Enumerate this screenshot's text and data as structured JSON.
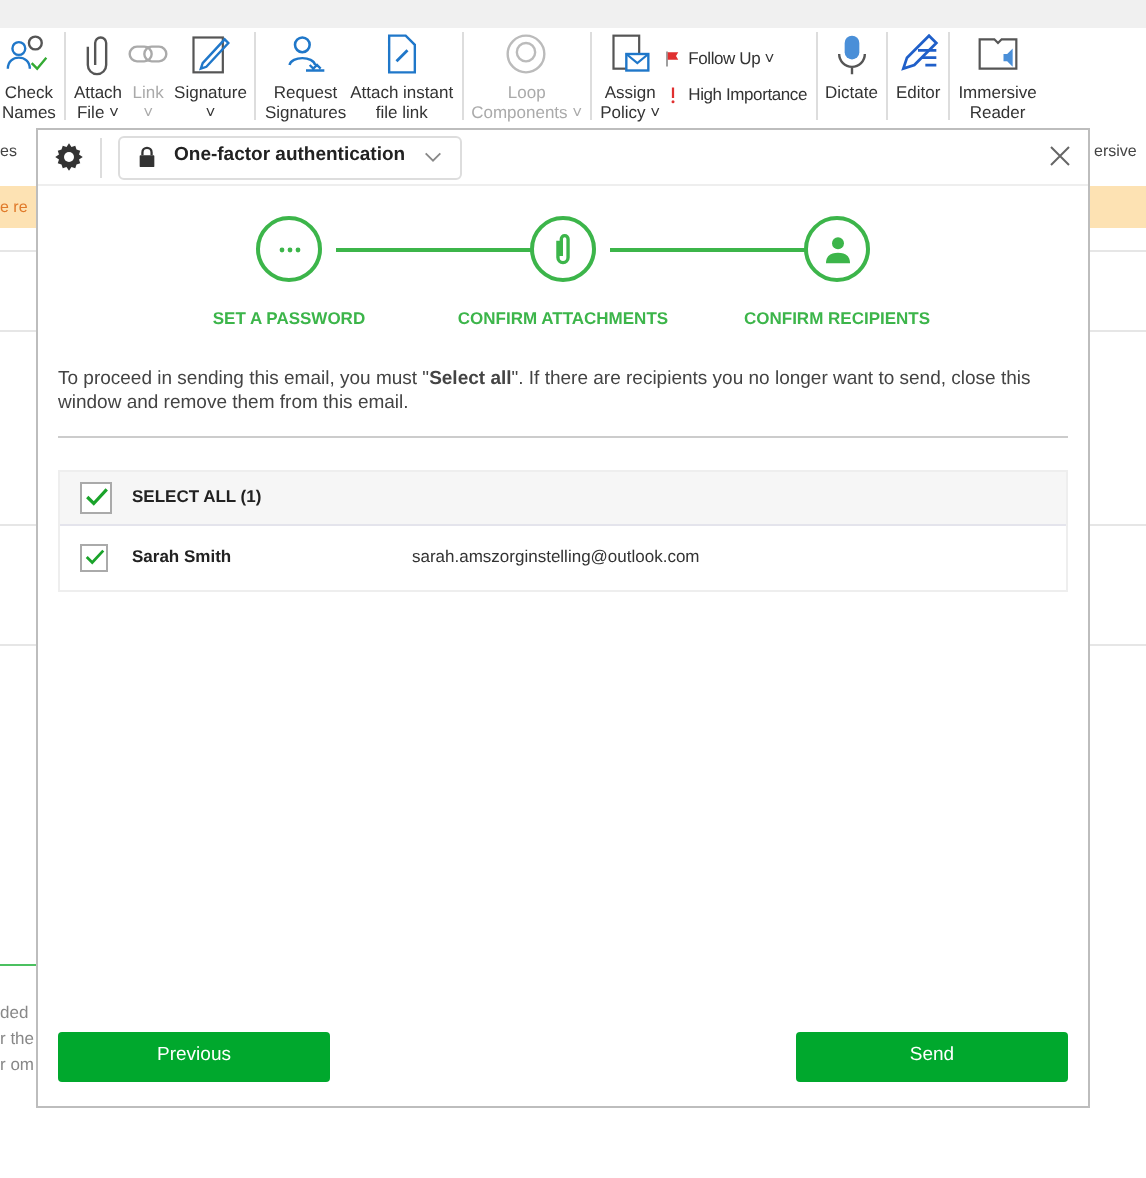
{
  "ribbon": {
    "items": [
      {
        "kind": "large",
        "lines": [
          "Check",
          "Names"
        ],
        "disabled": false
      },
      {
        "kind": "divider"
      },
      {
        "kind": "large",
        "lines": [
          "Attach",
          "File ˅"
        ],
        "disabled": false
      },
      {
        "kind": "large",
        "lines": [
          "Link",
          "˅"
        ],
        "disabled": true
      },
      {
        "kind": "large",
        "lines": [
          "Signature",
          "˅"
        ],
        "disabled": false
      },
      {
        "kind": "divider"
      },
      {
        "kind": "large",
        "lines": [
          "Request",
          "Signatures"
        ],
        "disabled": false
      },
      {
        "kind": "large",
        "lines": [
          "Attach instant",
          "file link"
        ],
        "disabled": false
      },
      {
        "kind": "divider"
      },
      {
        "kind": "large",
        "lines": [
          "Loop",
          "Components ˅"
        ],
        "disabled": true
      },
      {
        "kind": "divider"
      },
      {
        "kind": "large",
        "lines": [
          "Assign",
          "Policy ˅"
        ],
        "disabled": false
      },
      {
        "kind": "stack",
        "entries": [
          "Follow Up ˅",
          "High Importance"
        ]
      },
      {
        "kind": "divider"
      },
      {
        "kind": "large",
        "lines": [
          "Dictate"
        ],
        "disabled": false
      },
      {
        "kind": "divider"
      },
      {
        "kind": "large",
        "lines": [
          "Editor"
        ],
        "disabled": false
      },
      {
        "kind": "divider"
      },
      {
        "kind": "large",
        "lines": [
          "Immersive",
          "Reader"
        ],
        "disabled": false
      }
    ],
    "group_labels": [
      "es",
      "ersive"
    ]
  },
  "banner": {
    "text": "e re"
  },
  "background_lines": [
    "ded",
    "r the",
    "r om"
  ],
  "dialog": {
    "mode": "One-factor authentication",
    "steps": [
      {
        "label": "SET A PASSWORD",
        "done": true
      },
      {
        "label": "CONFIRM ATTACHMENTS",
        "done": true
      },
      {
        "label": "CONFIRM RECIPIENTS",
        "done": true
      }
    ],
    "instruction": "To proceed in sending this email, you must \"**Select all**\". If there are recipients you no longer want to send, close this window and remove them from this email.",
    "select_all": {
      "label": "SELECT ALL (1)",
      "checked": true
    },
    "recipients": [
      {
        "name": "Sarah Smith",
        "email": "sarah.amszorginstelling@outlook.com",
        "checked": true
      }
    ],
    "buttons": [
      "Previous",
      "Send"
    ]
  }
}
